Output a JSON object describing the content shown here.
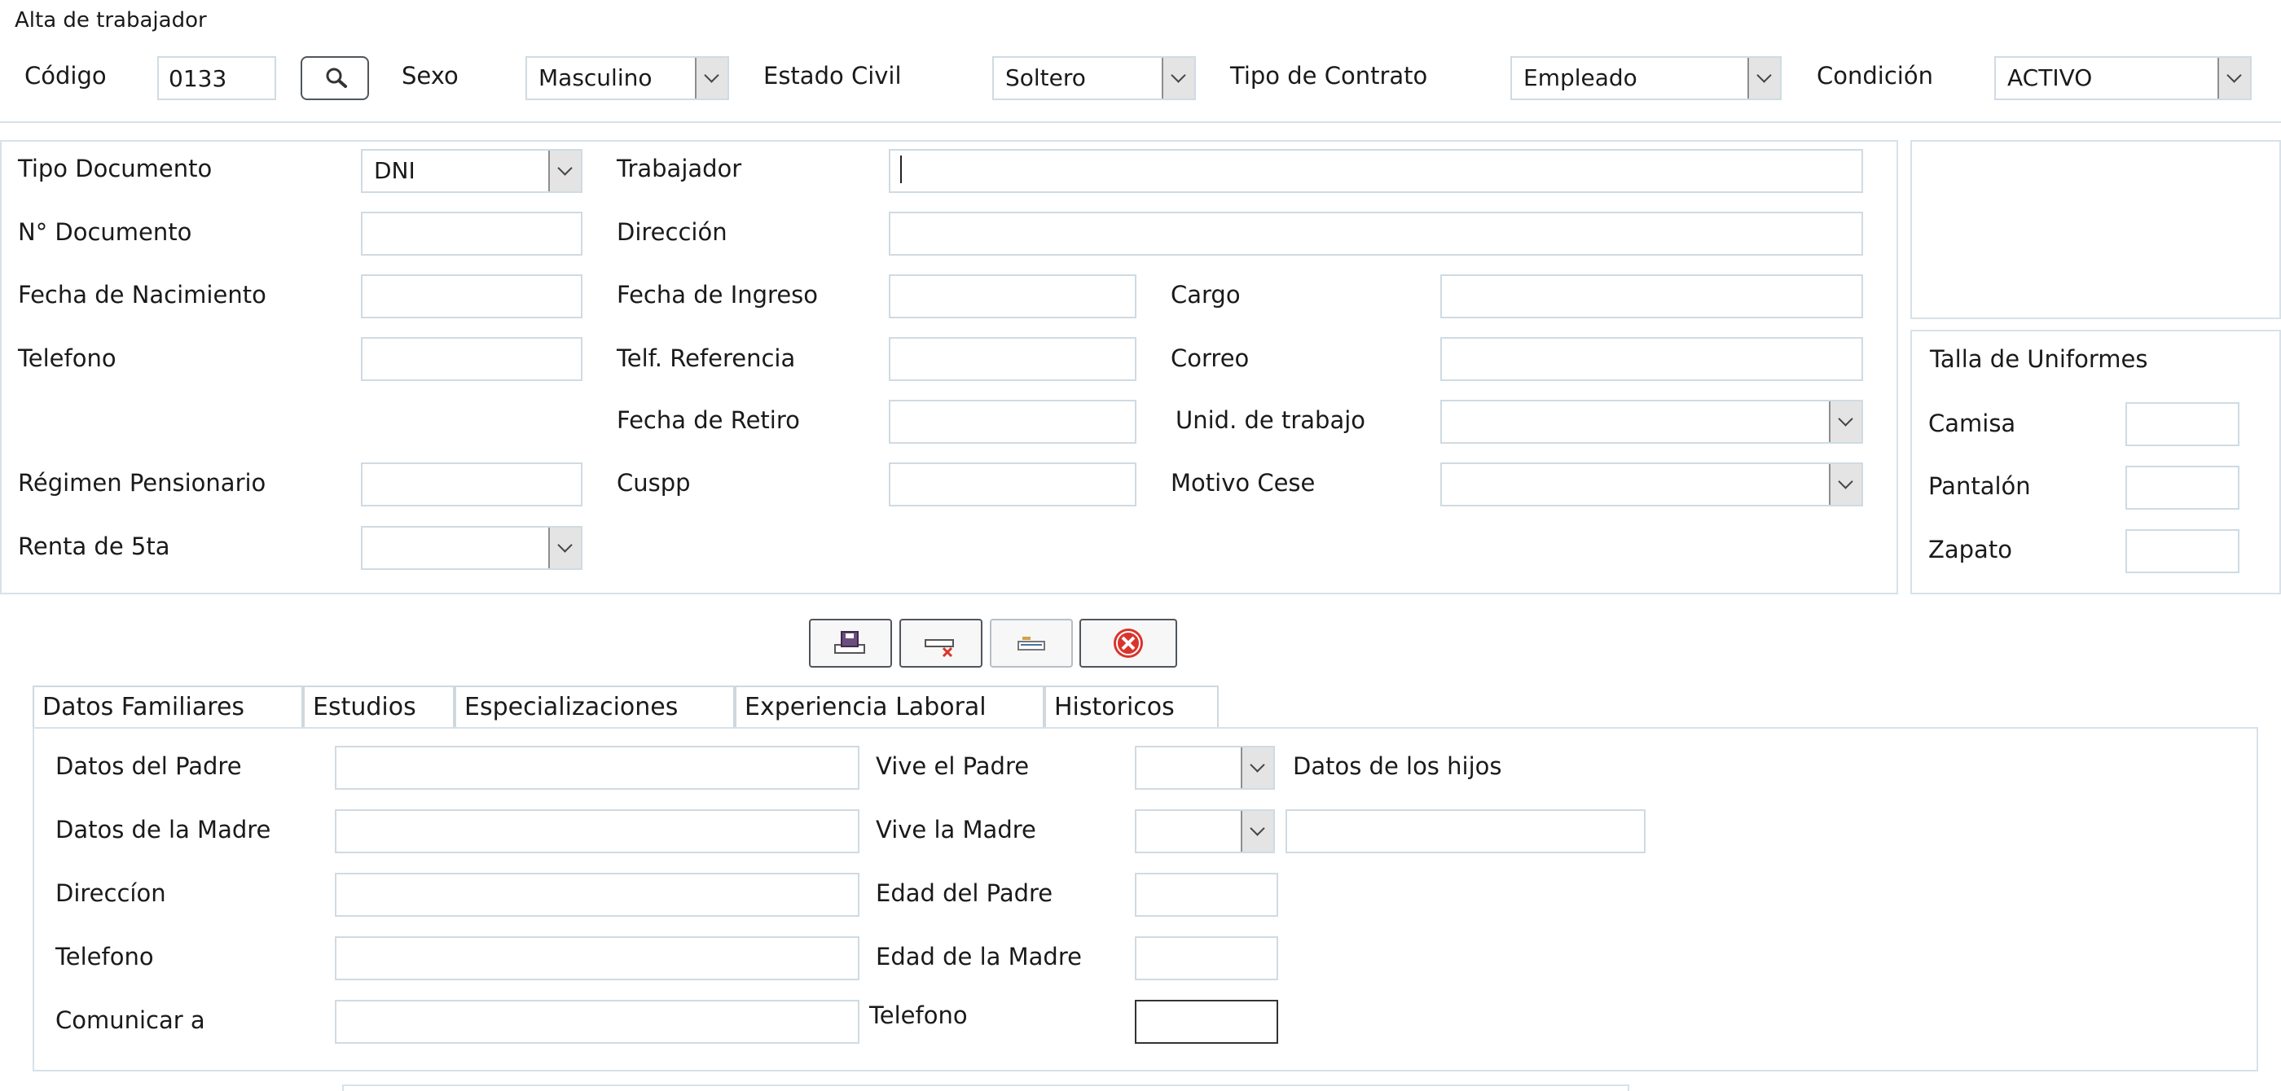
{
  "window": {
    "title": "Alta de trabajador"
  },
  "header": {
    "codigo_label": "Código",
    "codigo_value": "0133",
    "search_icon": "search-icon",
    "sexo_label": "Sexo",
    "sexo_value": "Masculino",
    "estado_civil_label": "Estado Civil",
    "estado_civil_value": "Soltero",
    "tipo_contrato_label": "Tipo de Contrato",
    "tipo_contrato_value": "Empleado",
    "condicion_label": "Condición",
    "condicion_value": "ACTIVO"
  },
  "form": {
    "tipo_documento_label": "Tipo Documento",
    "tipo_documento_value": "DNI",
    "trabajador_label": "Trabajador",
    "trabajador_value": "",
    "n_documento_label": "N° Documento",
    "direccion_label": "Dirección",
    "fecha_nacimiento_label": "Fecha de  Nacimiento",
    "fecha_ingreso_label": "Fecha de  Ingreso",
    "cargo_label": "Cargo",
    "telefono_label": "Telefono",
    "telf_referencia_label": "Telf. Referencia",
    "correo_label": "Correo",
    "fecha_retiro_label": "Fecha de  Retiro",
    "unid_trabajo_label": "Unid. de trabajo",
    "regimen_label": "Régimen Pensionario",
    "cuspp_label": "Cuspp",
    "motivo_cese_label": "Motivo Cese",
    "renta_label": "Renta de 5ta"
  },
  "uniformes": {
    "title": "Talla de Uniformes",
    "camisa_label": "Camisa",
    "pantalon_label": "Pantalón",
    "zapato_label": "Zapato"
  },
  "toolbar": {
    "save_icon": "save-icon",
    "delete_icon": "delete-icon",
    "print_icon": "print-icon",
    "close_icon": "close-icon"
  },
  "tabs": [
    {
      "label": "Datos Familiares"
    },
    {
      "label": "Estudios"
    },
    {
      "label": "Especializaciones"
    },
    {
      "label": "Experiencia Laboral"
    },
    {
      "label": "Historicos"
    }
  ],
  "familia": {
    "padre_label": "Datos del Padre",
    "madre_label": "Datos de la Madre",
    "direccion_label": "Direccíon",
    "telefono_label": "Telefono",
    "comunicar_label": "Comunicar a",
    "vive_padre_label": "Vive el Padre",
    "vive_madre_label": "Vive la Madre",
    "edad_padre_label": "Edad del Padre",
    "edad_madre_label": "Edad de la Madre",
    "telefono2_label": "Telefono",
    "hijos_label": "Datos de los hijos"
  },
  "colors": {
    "border": "#cfdbe3",
    "close_red": "#d9342b",
    "save_purple": "#6b4d7e"
  }
}
